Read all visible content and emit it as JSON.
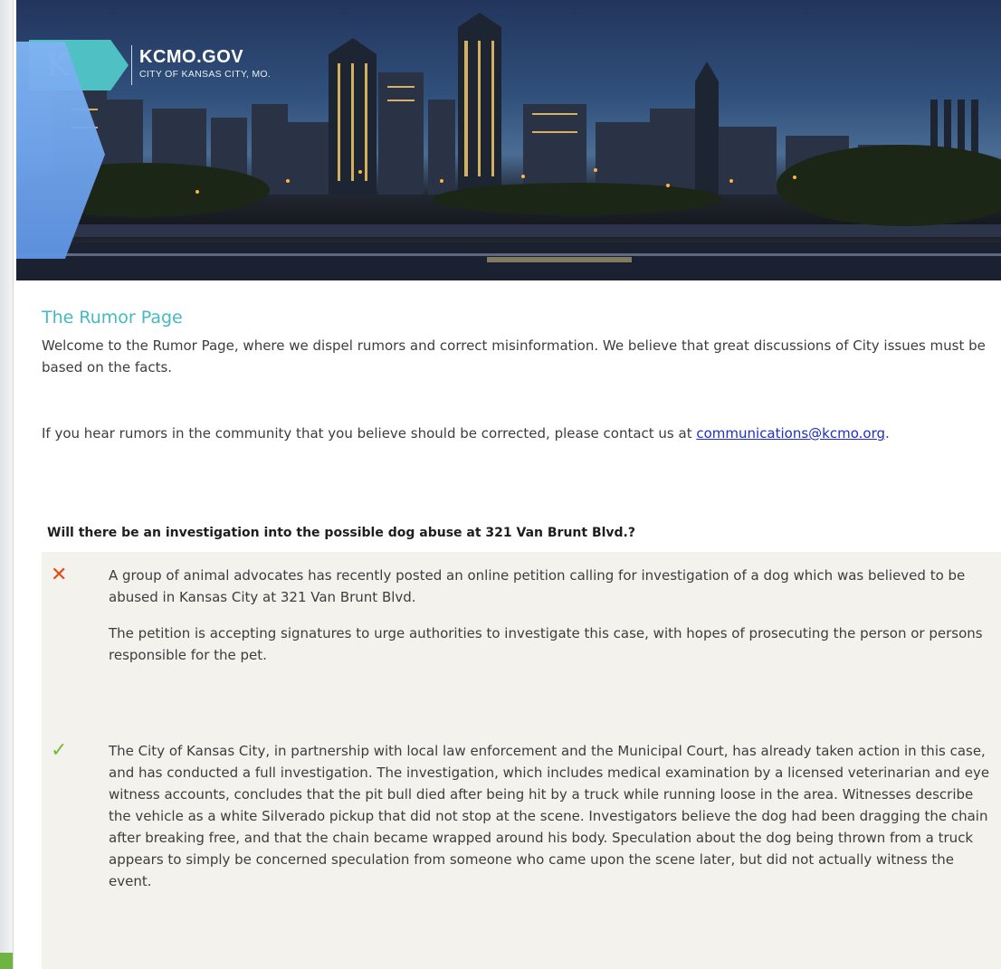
{
  "brand": {
    "logo_letter": "K",
    "site_name": "KCMO.GOV",
    "tagline": "CITY OF KANSAS CITY, MO."
  },
  "page": {
    "title": "The Rumor Page",
    "intro": "Welcome to the Rumor Page, where we dispel rumors and correct misinformation. We believe that great discussions of City issues must be based on the facts.",
    "contact_text": "If you hear rumors in the community that you believe should be corrected, please contact us at ",
    "contact_email": "communications@kcmo.org",
    "contact_suffix": "."
  },
  "rumor": {
    "question": "Will there be an investigation into the possible dog abuse at 321 Van Brunt Blvd.?",
    "rumor_mark": "✕",
    "rumor_paragraphs": [
      "A group of animal advocates has recently posted an online petition calling for investigation of a dog which was believed to be abused in Kansas City at 321 Van Brunt Blvd.",
      "The petition is accepting signatures to urge authorities to investigate this case, with hopes of prosecuting the person or persons responsible for the pet."
    ],
    "fact_mark": "✓",
    "fact_paragraph": "The City of Kansas City, in partnership with local law enforcement and the Municipal Court, has already taken action in this case, and has conducted a full investigation. The investigation, which includes medical examination by a licensed veterinarian and eye witness accounts, concludes that the pit bull died after being hit by a truck while running loose in the area. Witnesses describe the vehicle as a white Silverado pickup that did not stop at the scene. Investigators believe the dog had been dragging the chain after breaking free, and that the chain became wrapped around his body. Speculation about the dog being thrown from a truck appears to simply be concerned speculation from someone who came upon the scene later, but did not actually witness the event."
  },
  "colors": {
    "title_teal": "#45b9c1",
    "brand_tab": "#4fc0c3",
    "link_blue": "#1f2fbf",
    "x_red": "#e34a1a",
    "check_green": "#6bbf3a",
    "box_bg": "#f3f2ed"
  }
}
